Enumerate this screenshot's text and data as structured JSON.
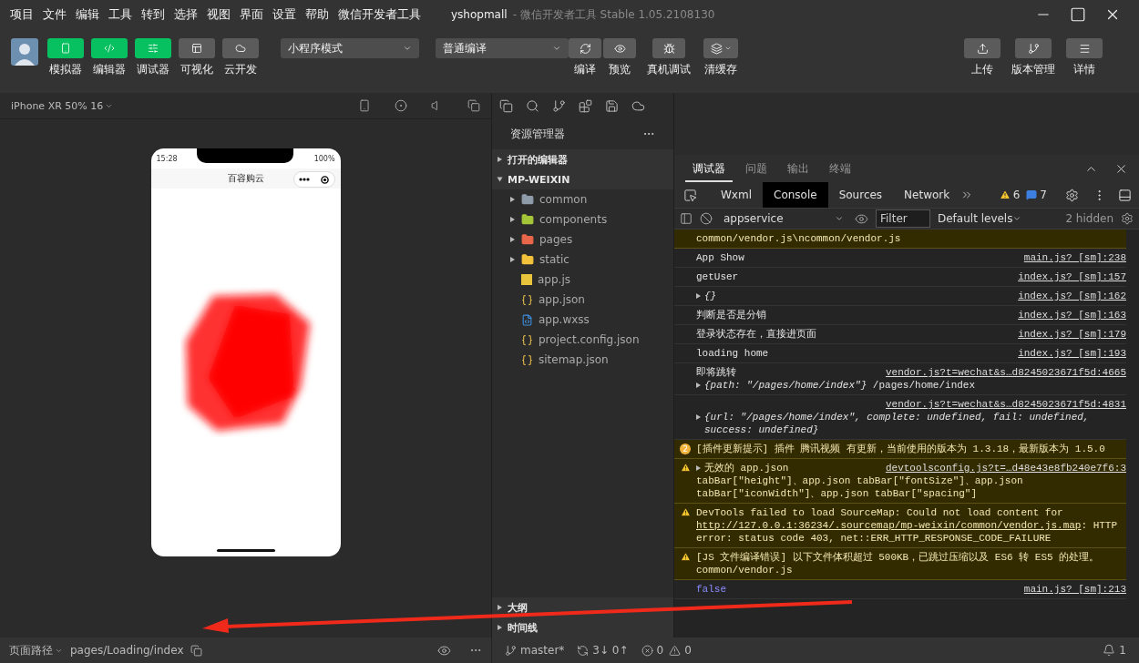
{
  "menu": [
    "项目",
    "文件",
    "编辑",
    "工具",
    "转到",
    "选择",
    "视图",
    "界面",
    "设置",
    "帮助",
    "微信开发者工具"
  ],
  "window": {
    "title": "yshopmall",
    "subtitle": "- 微信开发者工具 Stable 1.05.2108130"
  },
  "toolbar": {
    "panel_toggles": [
      {
        "label": "模拟器",
        "selected": true
      },
      {
        "label": "编辑器",
        "selected": true
      },
      {
        "label": "调试器",
        "selected": true
      },
      {
        "label": "可视化",
        "selected": false
      },
      {
        "label": "云开发",
        "selected": false
      }
    ],
    "mode_select": "小程序模式",
    "compile_select": "普通编译",
    "actions": [
      "编译",
      "预览",
      "真机调试",
      "清缓存"
    ],
    "right_actions": [
      "上传",
      "版本管理",
      "详情"
    ]
  },
  "simulator": {
    "device": "iPhone XR 50% 16",
    "phone": {
      "time": "15:28",
      "battery": "100%",
      "page_title": "百容购云"
    }
  },
  "explorer": {
    "title": "资源管理器",
    "sections": [
      {
        "label": "打开的编辑器",
        "expanded": false
      },
      {
        "label": "MP-WEIXIN",
        "expanded": true,
        "children": [
          {
            "name": "common",
            "kind": "folder",
            "color": "#8e9ba8",
            "expanded": false
          },
          {
            "name": "components",
            "kind": "folder",
            "color": "#a4c639",
            "expanded": false
          },
          {
            "name": "pages",
            "kind": "folder",
            "color": "#e8664a",
            "expanded": false
          },
          {
            "name": "static",
            "kind": "folder",
            "color": "#f2c23a",
            "expanded": false
          },
          {
            "name": "app.js",
            "kind": "js"
          },
          {
            "name": "app.json",
            "kind": "json"
          },
          {
            "name": "app.wxss",
            "kind": "wxss"
          },
          {
            "name": "project.config.json",
            "kind": "json"
          },
          {
            "name": "sitemap.json",
            "kind": "json"
          }
        ]
      }
    ],
    "bottom_sections": [
      {
        "label": "大纲",
        "expanded": false
      },
      {
        "label": "时间线",
        "expanded": false
      }
    ]
  },
  "debugger": {
    "tabs": [
      {
        "label": "调试器",
        "selected": true
      },
      {
        "label": "问题",
        "selected": false
      },
      {
        "label": "输出",
        "selected": false
      },
      {
        "label": "终端",
        "selected": false
      }
    ],
    "devtools_tabs": [
      {
        "label": "Wxml",
        "selected": false
      },
      {
        "label": "Console",
        "selected": true
      },
      {
        "label": "Sources",
        "selected": false
      },
      {
        "label": "Network",
        "selected": false
      }
    ],
    "warning_count": "6",
    "info_count": "7",
    "context": "appservice",
    "filter": {
      "placeholder": "Filter"
    },
    "levels": "Default levels",
    "hidden": "2 hidden",
    "console": [
      {
        "kind": "warning_tail",
        "text": "common/vendor.js\\ncommon/vendor.js"
      },
      {
        "kind": "log",
        "text": "App Show",
        "source": "main.js? [sm]:238"
      },
      {
        "kind": "log",
        "text": "getUser",
        "source": "index.js? [sm]:157"
      },
      {
        "kind": "log",
        "text": "*{}*",
        "source": "index.js? [sm]:162",
        "expanded": false
      },
      {
        "kind": "log",
        "text": "判断是否是分销",
        "source": "index.js? [sm]:163"
      },
      {
        "kind": "log",
        "text": "登录状态存在，直接进页面",
        "source": "index.js? [sm]:179"
      },
      {
        "kind": "log",
        "text": "loading home",
        "source": "index.js? [sm]:193"
      },
      {
        "kind": "log",
        "text": "即将跳转",
        "source": "vendor.js?t=wechat&s…d8245023671f5d:4665",
        "detail": "*{path: \"/pages/home/index\"}* /pages/home/index",
        "expanded": false
      },
      {
        "kind": "log",
        "source": "vendor.js?t=wechat&s…d8245023671f5d:4831",
        "detail": "*{url: \"/pages/home/index\", complete: undefined, fail: undefined, success: undefined}*",
        "expanded": false
      },
      {
        "kind": "plugin",
        "badge": "2",
        "text": "[插件更新提示] 插件 腾讯视频 有更新，当前使用的版本为 1.3.18，最新版本为 1.5.0"
      },
      {
        "kind": "warning",
        "text": "无效的 app.json",
        "source": "devtoolsconfig.js?t=…d48e43e8fb240e7f6:3",
        "detail": "tabBar[\"height\"]、app.json tabBar[\"fontSize\"]、app.json tabBar[\"iconWidth\"]、app.json tabBar[\"spacing\"]",
        "expanded": false
      },
      {
        "kind": "warning",
        "text": "DevTools failed to load SourceMap: Could not load content for",
        "link": "http://127.0.0.1:36234/.sourcemap/mp-weixin/common/vendor.js.map",
        "after": ": HTTP error: status code 403, net::ERR_HTTP_RESPONSE_CODE_FAILURE"
      },
      {
        "kind": "warning",
        "text": "[JS 文件编译错误] 以下文件体积超过 500KB，已跳过压缩以及 ES6 转 ES5 的处理。",
        "detail": "common/vendor.js"
      },
      {
        "kind": "value",
        "text": "false",
        "source": "main.js? [sm]:213"
      }
    ]
  },
  "status_bar": {
    "path_label": "页面路径",
    "path": "pages/Loading/index",
    "branch": "master*",
    "sync": "3↓ 0↑",
    "errors": "0",
    "warnings": "0",
    "notifications": "1"
  }
}
